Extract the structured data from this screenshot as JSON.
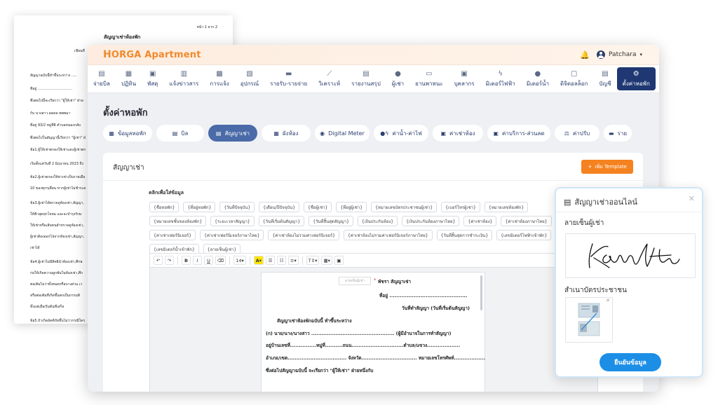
{
  "paper": {
    "page": "หน้า 1 จาก 2",
    "title": "สัญญาเช่าห้องพัก",
    "wrote": "เขียนที่",
    "lines": [
      "สัญญาฉบับนี้ทำขึ้นระหว่าง .....",
      "ที่อยู่ ...............................",
      "ซึ่งต่อไปนี้จะเรียกว่า \"ผู้ให้เช่า\" ฝ่าย",
      "กับ นางสาว ดดดด พพพมา",
      "ที่อยู่ 93/2 หมู่ที่8 ตำบลหนองกลับ",
      "ซึ่งต่อไปในสัญญานี้เรียกว่า \"ผู้เช่า\" ฝ่",
      "ข้อ1.ผู้ให้เช่าตกลงให้เช่าและผู้เช่าตก",
      "เริ่มตั้งแต่วันที่ 2 มิถุนายน 2023 ถึง",
      "ข้อ2.ผู้เช่าตกลงให้ค่าเช่าเป็นรายเดือ",
      "10 ของทุกๆเดือน หากผู้เช่าไม่ชำระค",
      "ข้อ3.ผู้เช่าได้ตรวจดูห้องเช่า,สัญญา,",
      "ให้ฟ้าสุดทุกโจทม และจะบำรุงรักษ",
      "ให้เช่าหรือเส้นทนสำหรวจดูห้องเช่า,",
      "ผู้เช่าต้องออกไปจากห้องเช่า,สัญญา,",
      "เช่าได้",
      "ข้อ4.ผู้เช่าไม่มีสิทธินำห้องเช่า,ศึกษ",
      "ก่อให้เกิดความผูกพันในห้องเช่า,ศึก",
      "ต่อเติมไม่ว่าทั้งหมดหรือบางส่วน เว",
      "หรือต่อเติมที่เกิดขึ้นตกเป็นกรรมสิ",
      "ทั้งแต่เมื่อเริ่มต้นที่เสร็จ",
      "ข้อ5.ถ้าเกิดอัคคีภัยขึ้นไม่ว่ากรณีใดๆ"
    ]
  },
  "app": {
    "logo_letter": "H",
    "logo_rest": "ORGA Apartment",
    "user": "Patchara"
  },
  "nav": [
    {
      "label": "จ่ายบิล",
      "icon": "doc-icon",
      "glyph": "▤"
    },
    {
      "label": "ปฏิทิน",
      "icon": "calendar-icon",
      "glyph": "▦"
    },
    {
      "label": "พัสดุ",
      "icon": "package-icon",
      "glyph": "▣"
    },
    {
      "label": "แจ้งข่าวสาร",
      "icon": "news-icon",
      "glyph": "▥"
    },
    {
      "label": "การแจ้ง",
      "icon": "report-icon",
      "glyph": "▩"
    },
    {
      "label": "อุปกรณ์",
      "icon": "toolbox-icon",
      "glyph": "▧"
    },
    {
      "label": "รายรับ-รายจ่าย",
      "icon": "wallet-icon",
      "glyph": "▬"
    },
    {
      "label": "วิเคราะห์",
      "icon": "chart-icon",
      "glyph": "⟋"
    },
    {
      "label": "รายงานสรุป",
      "icon": "summary-icon",
      "glyph": "▤"
    },
    {
      "label": "ผู้เช่า",
      "icon": "tenants-icon",
      "glyph": "●"
    },
    {
      "label": "ยานพาหนะ",
      "icon": "car-icon",
      "glyph": "▭"
    },
    {
      "label": "บุคลากร",
      "icon": "staff-icon",
      "glyph": "▣"
    },
    {
      "label": "มิเตอร์ไฟฟ้า",
      "icon": "lightning-icon",
      "glyph": "ϟ"
    },
    {
      "label": "มิเตอร์น้ำ",
      "icon": "water-drop-icon",
      "glyph": "●"
    },
    {
      "label": "ดิจิตอลล็อก",
      "icon": "lock-icon",
      "glyph": "▢"
    },
    {
      "label": "บัญชี",
      "icon": "ledger-icon",
      "glyph": "▤"
    },
    {
      "label": "ตั้งค่าหอพัก",
      "icon": "gear-icon",
      "glyph": "⚙"
    }
  ],
  "page_title": "ตั้งค่าหอพัก",
  "tabs": [
    {
      "label": "ข้อมูลหอพัก",
      "icon": "building-icon",
      "glyph": "▦"
    },
    {
      "label": "บิล",
      "icon": "bill-icon",
      "glyph": "▤"
    },
    {
      "label": "สัญญาเช่า",
      "icon": "contract-icon",
      "glyph": "▤"
    },
    {
      "label": "ผังห้อง",
      "icon": "floorplan-icon",
      "glyph": "▦"
    },
    {
      "label": "Digital Meter",
      "icon": "meter-icon",
      "glyph": "◉"
    },
    {
      "label": "ค่าน้ำ-ค่าไฟ",
      "icon": "utility-icon",
      "glyph": "●ϟ"
    },
    {
      "label": "ค่าเช่าห้อง",
      "icon": "rent-icon",
      "glyph": "▣"
    },
    {
      "label": "ค่าบริการ-ส่วนลด",
      "icon": "discount-icon",
      "glyph": "▣"
    },
    {
      "label": "ค่าปรับ",
      "icon": "fine-icon",
      "glyph": "⚖"
    },
    {
      "label": "ราย",
      "icon": "list-icon",
      "glyph": "▬"
    }
  ],
  "card": {
    "title": "สัญญาเช่า",
    "add_button": "เพิ่ม Template",
    "click_hint": "คลิกเพื่อใส่ข้อมูล",
    "chips": [
      "{ชื่อหอพัก}",
      "{ที่อยู่หอพัก}",
      "{วันที่ปัจจุบัน}",
      "{เดือน/ปีปัจจุบัน}",
      "{ชื่อผู้เช่า}",
      "{ที่อยู่ผู้เช่า}",
      "{หมายเลขบัตรประชาชนผู้เช่า}",
      "{เบอร์โทรผู้เช่า}",
      "{หมายเลขห้องพัก}",
      "{หมายเลขชั้นของห้องพัก}",
      "{ระยะเวลาสัญญา}",
      "{วันที่เริ่มต้นสัญญา}",
      "{วันที่สิ้นสุดสัญญา}",
      "{เงินประกันห้อง}",
      "{เงินประกันห้องภาษาไทย}",
      "{ค่าเช่าห้อง}",
      "{ค่าเช่าห้องภาษาไทย}",
      "{ค่าเช่าเฟอร์นิเจอร์}",
      "{ค่าเช่าเฟอร์นิเจอร์ภาษาไทย}",
      "{ค่าเช่าห้องไม่รวมค่าเฟอร์นิเจอร์}",
      "{ค่าเช่าห้องไม่รวมค่าเฟอร์นิเจอร์ภาษาไทย}",
      "{วันที่สิ้นสุดการชำระเงิน}",
      "{เลขมิเตอร์ไฟฟ้าเข้าพัก}",
      "{เลขมิเตอร์น้ำเข้าพัก}",
      "{ลายเซ็นผู้เช่า}"
    ]
  },
  "editor": {
    "font_size": "14",
    "sig_placeholder": "ลายเซ็นผู้เช่า",
    "doc_lines": [
      "พัชรา สัญญาเช่า",
      "ที่อยู่ .............................................",
      "วันที่ทำสัญญา (วันที่เริ่มต้นสัญญา)",
      "สัญญาเช่าห้องพักฉบับนี้ ทำขึ้นระหว่าง",
      "(ก) นาย/นาง/นางสาว ................................................ (ผู้มีอำนาจในการทำสัญญา)",
      "อยู่บ้านเลขที่...............หมู่ที่..........ถนน..............................ตำบล/แขวง...................",
      "อำเภอ/เขต.................................. จังหวัด................................ หมายเลขโทรศัพท์..................",
      "ซึ่งต่อไปสัญญาฉบับนี้ จะเรียกว่า \"ผู้ให้เช่า\" ฝ่ายหนึ่งกับ"
    ]
  },
  "modal": {
    "title": "สัญญาเช่าออนไลน์",
    "signature_label": "ลายเซ็นผู้เช่า",
    "id_label": "สำเนาบัตรประชาชน",
    "confirm": "ยืนยันข้อมูล"
  },
  "colors": {
    "accent": "#f08a2c",
    "primary": "#1f3772",
    "tab_active": "#4a6aa8",
    "confirm": "#1c8ee6"
  }
}
